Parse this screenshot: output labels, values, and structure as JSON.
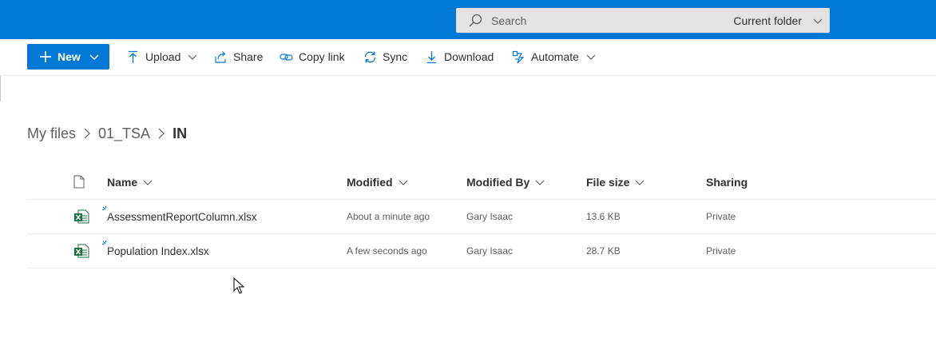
{
  "search": {
    "placeholder": "Search",
    "scope": "Current folder"
  },
  "commandbar": {
    "new_label": "New",
    "upload_label": "Upload",
    "share_label": "Share",
    "copy_link_label": "Copy link",
    "sync_label": "Sync",
    "download_label": "Download",
    "automate_label": "Automate"
  },
  "breadcrumb": {
    "items": [
      "My files",
      "01_TSA",
      "IN"
    ]
  },
  "table": {
    "columns": {
      "name": "Name",
      "modified": "Modified",
      "modified_by": "Modified By",
      "file_size": "File size",
      "sharing": "Sharing"
    },
    "rows": [
      {
        "name": "AssessmentReportColumn.xlsx",
        "modified": "About a minute ago",
        "modified_by": "Gary Isaac",
        "file_size": "13.6 KB",
        "sharing": "Private"
      },
      {
        "name": "Population Index.xlsx",
        "modified": "A few seconds ago",
        "modified_by": "Gary Isaac",
        "file_size": "28.7 KB",
        "sharing": "Private"
      }
    ]
  },
  "colors": {
    "brand_blue": "#0078d4",
    "excel_green": "#1d6f42"
  }
}
